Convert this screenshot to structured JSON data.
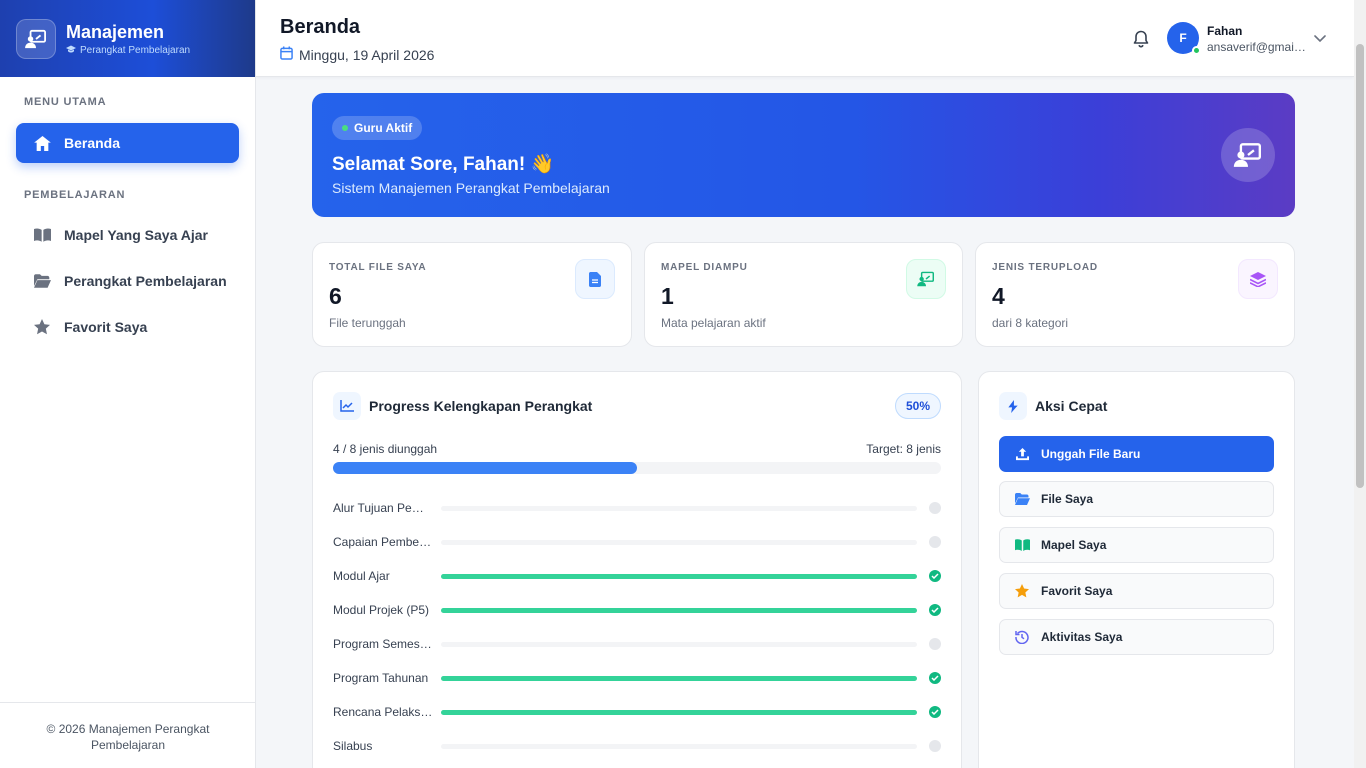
{
  "brand": {
    "title": "Manajemen",
    "subtitle": "Perangkat Pembelajaran"
  },
  "sidebar": {
    "section_main": "MENU UTAMA",
    "section_learning": "PEMBELAJARAN",
    "items": [
      {
        "label": "Beranda",
        "icon": "home-icon",
        "active": true
      },
      {
        "label": "Mapel Yang Saya Ajar",
        "icon": "book-icon"
      },
      {
        "label": "Perangkat Pembelajaran",
        "icon": "folder-icon"
      },
      {
        "label": "Favorit Saya",
        "icon": "star-icon"
      }
    ],
    "footer": "© 2026 Manajemen Perangkat Pembelajaran"
  },
  "header": {
    "title": "Beranda",
    "date": "Minggu, 19 April 2026",
    "user": {
      "initial": "F",
      "name": "Fahan",
      "email": "ansaverif@gmail.com"
    }
  },
  "hero": {
    "badge": "Guru Aktif",
    "title": "Selamat Sore, Fahan! 👋",
    "subtitle": "Sistem Manajemen Perangkat Pembelajaran"
  },
  "stats": [
    {
      "label": "TOTAL FILE SAYA",
      "value": "6",
      "note": "File terunggah",
      "icon": "file-icon",
      "color": "#3b82f6"
    },
    {
      "label": "MAPEL DIAMPU",
      "value": "1",
      "note": "Mata pelajaran aktif",
      "icon": "teacher-icon",
      "color": "#10b981"
    },
    {
      "label": "JENIS TERUPLOAD",
      "value": "4",
      "note": "dari 8 kategori",
      "icon": "layers-icon",
      "color": "#a855f7"
    }
  ],
  "progress": {
    "title": "Progress Kelengkapan Perangkat",
    "percent_label": "50%",
    "percent": 50,
    "count_label": "4 / 8 jenis diunggah",
    "target_label": "Target: 8 jenis",
    "rows": [
      {
        "label": "Alur Tujuan Pembelajaran",
        "done": false
      },
      {
        "label": "Capaian Pembelajaran",
        "done": false
      },
      {
        "label": "Modul Ajar",
        "done": true
      },
      {
        "label": "Modul Projek (P5)",
        "done": true
      },
      {
        "label": "Program Semester",
        "done": false
      },
      {
        "label": "Program Tahunan",
        "done": true
      },
      {
        "label": "Rencana Pelaksanaan",
        "done": true
      },
      {
        "label": "Silabus",
        "done": false
      }
    ]
  },
  "quick_actions": {
    "title": "Aksi Cepat",
    "items": [
      {
        "label": "Unggah File Baru",
        "icon": "upload-icon",
        "primary": true
      },
      {
        "label": "File Saya",
        "icon": "folder-icon"
      },
      {
        "label": "Mapel Saya",
        "icon": "book-icon"
      },
      {
        "label": "Favorit Saya",
        "icon": "star-icon"
      },
      {
        "label": "Aktivitas Saya",
        "icon": "history-icon"
      }
    ]
  },
  "colors": {
    "primary": "#2563eb",
    "success": "#10b981",
    "star": "#f59e0b"
  }
}
